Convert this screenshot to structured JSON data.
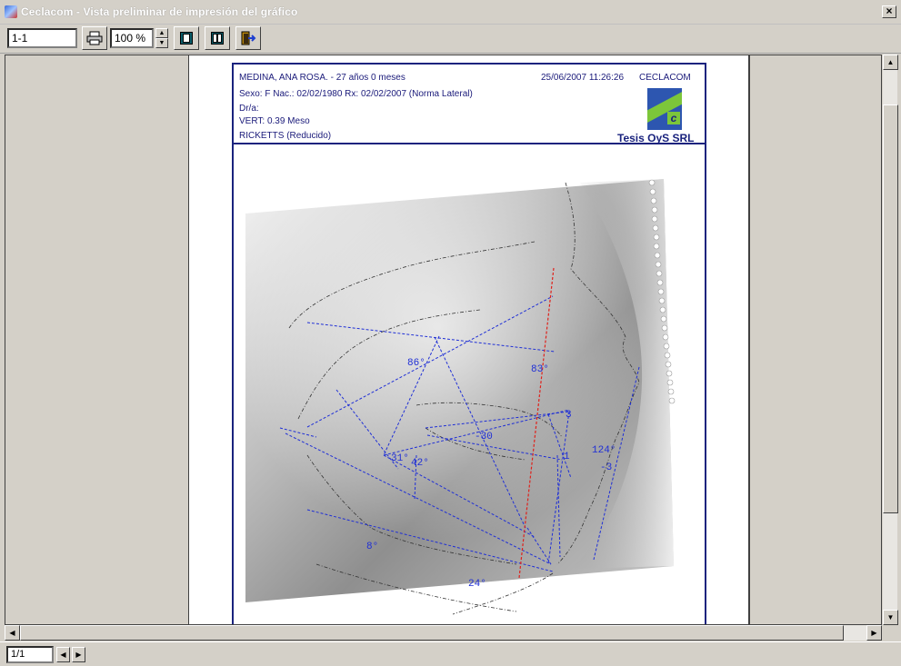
{
  "window": {
    "title": "Ceclacom - Vista preliminar de impresión del gráfico",
    "close_label": "×"
  },
  "toolbar": {
    "page_range_value": "1-1",
    "zoom_value": "100 %",
    "icons": [
      "printer-icon",
      "single-page-icon",
      "two-pages-icon",
      "exit-icon"
    ]
  },
  "report": {
    "patient": "MEDINA, ANA ROSA. - 27 años 0 meses",
    "datetime": "25/06/2007 11:26:26",
    "company": "CECLACOM",
    "demographics": "Sexo: F   Nac.: 02/02/1980    Rx: 02/02/2007 (Norma Lateral)",
    "doctor": "Dr/a:",
    "vert": "VERT: 0.39 Meso",
    "analysis": "RICKETTS (Reducido)",
    "brand": "Tesis OyS SRL",
    "logo_letter": "c"
  },
  "tracing": {
    "labels": {
      "a86": "86°",
      "a83": "83°",
      "a3": "3",
      "m30": "-30",
      "a1": "1",
      "a124": "124°",
      "m3": "-3",
      "a31": "31°",
      "a42": "42°",
      "a8": "8°",
      "a24": "24°"
    },
    "colors": {
      "trace": "#1f2fd6",
      "facial_line": "#e0201a",
      "contour": "#333333"
    }
  },
  "statusbar": {
    "page_indicator": "1/1"
  }
}
